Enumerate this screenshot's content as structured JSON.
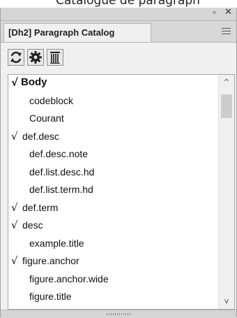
{
  "caption": "Catalogue de paragraph",
  "panel": {
    "title_tab": "[Dh2] Paragraph Catalog",
    "collapse_glyph": "«",
    "close_glyph": "✕"
  },
  "toolbar": {
    "buttons": [
      {
        "name": "refresh-icon"
      },
      {
        "name": "gear-icon"
      },
      {
        "name": "paragraph-delete-icon"
      }
    ]
  },
  "list": {
    "items": [
      {
        "label": "Body",
        "checked": true,
        "bold": true
      },
      {
        "label": "codeblock",
        "checked": false
      },
      {
        "label": "Courant",
        "checked": false
      },
      {
        "label": "def.desc",
        "checked": true
      },
      {
        "label": "def.desc.note",
        "checked": false
      },
      {
        "label": "def.list.desc.hd",
        "checked": false
      },
      {
        "label": "def.list.term.hd",
        "checked": false
      },
      {
        "label": "def.term",
        "checked": true
      },
      {
        "label": "desc",
        "checked": true
      },
      {
        "label": "example.title",
        "checked": false
      },
      {
        "label": "figure.anchor",
        "checked": true
      },
      {
        "label": "figure.anchor.wide",
        "checked": false
      },
      {
        "label": "figure.title",
        "checked": false
      }
    ],
    "check_glyph": "√"
  },
  "scroll": {
    "up_glyph": "^",
    "down_glyph": "v"
  }
}
